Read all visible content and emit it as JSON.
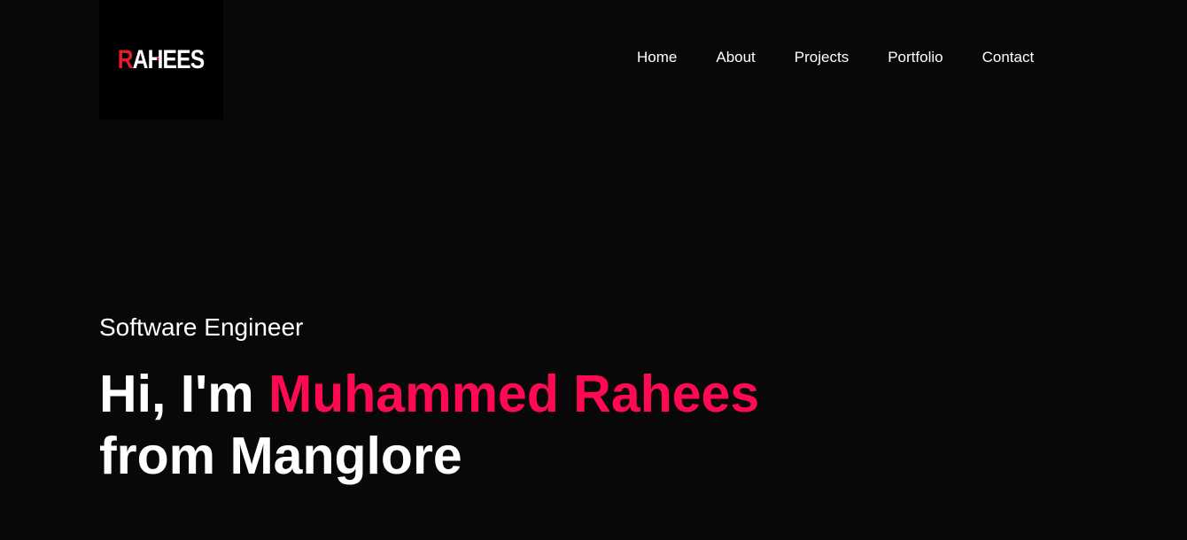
{
  "logo": {
    "first_letter": "R",
    "rest": "AHEES",
    "accent_color": "#e11d2a"
  },
  "nav": {
    "items": [
      {
        "label": "Home"
      },
      {
        "label": "About"
      },
      {
        "label": "Projects"
      },
      {
        "label": "Portfolio"
      },
      {
        "label": "Contact"
      }
    ]
  },
  "hero": {
    "role": "Software Engineer",
    "greeting": "Hi, I'm ",
    "name": "Muhammed Rahees",
    "location_line": "from Manglore",
    "name_color": "#ff0a52"
  },
  "theme": {
    "background": "#080808",
    "text": "#ffffff"
  }
}
